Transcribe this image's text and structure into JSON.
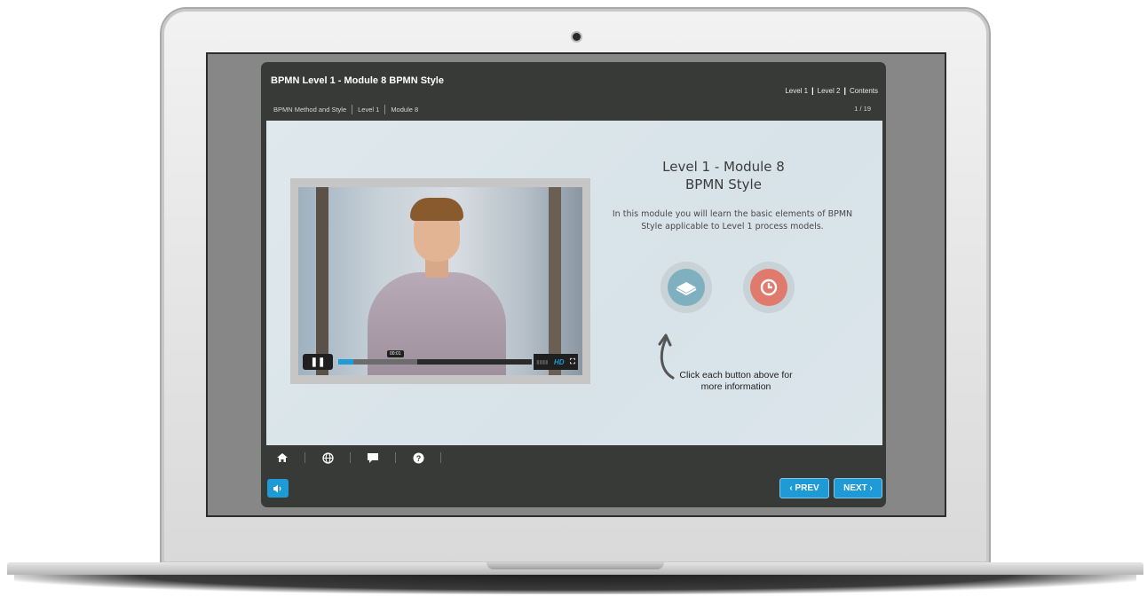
{
  "app": {
    "title": "BPMN Level 1 - Module 8 BPMN Style",
    "top_nav": {
      "level1": "Level 1",
      "level2": "Level 2",
      "contents": "Contents",
      "separator": "|"
    },
    "breadcrumb": [
      "BPMN Method and Style",
      "Level 1",
      "Module 8"
    ],
    "page_counter": "1 / 19"
  },
  "content": {
    "title_line1": "Level 1 - Module 8",
    "title_line2": "BPMN Style",
    "description": "In this module you will learn the basic elements of BPMN Style applicable to Level 1 process models.",
    "hint": "Click each button above for more information",
    "buttons": [
      {
        "icon": "book-icon",
        "color": "#7fb0bf"
      },
      {
        "icon": "clock-icon",
        "color": "#e07a6c"
      }
    ]
  },
  "video": {
    "time": "00:01",
    "progress": 0.08,
    "buffered": 0.41,
    "hd_label": "HD",
    "state": "playing"
  },
  "footer": {
    "toolbar": [
      "home-icon",
      "globe-icon",
      "chat-icon",
      "help-icon"
    ],
    "prev_label": "‹ PREV",
    "next_label": "NEXT ›"
  },
  "colors": {
    "accent": "#1e9ad6",
    "header_bg": "#383a37",
    "content_bg": "#dfe8ec"
  }
}
